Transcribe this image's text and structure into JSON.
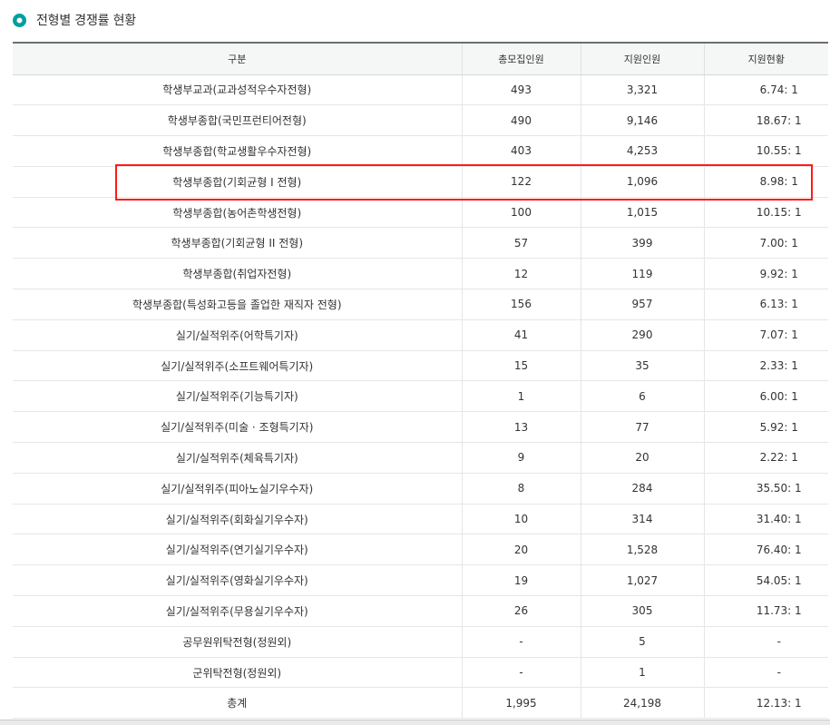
{
  "section": {
    "title": "전형별 경쟁률 현황"
  },
  "table": {
    "headers": [
      "구분",
      "총모집인원",
      "지원인원",
      "지원현황"
    ],
    "rows": [
      [
        "학생부교과(교과성적우수자전형)",
        "493",
        "3,321",
        "6.74: 1"
      ],
      [
        "학생부종합(국민프런티어전형)",
        "490",
        "9,146",
        "18.67: 1"
      ],
      [
        "학생부종합(학교생활우수자전형)",
        "403",
        "4,253",
        "10.55: 1"
      ],
      [
        "학생부종합(기회균형 I 전형)",
        "122",
        "1,096",
        "8.98: 1"
      ],
      [
        "학생부종합(농어촌학생전형)",
        "100",
        "1,015",
        "10.15: 1"
      ],
      [
        "학생부종합(기회균형 II 전형)",
        "57",
        "399",
        "7.00: 1"
      ],
      [
        "학생부종합(취업자전형)",
        "12",
        "119",
        "9.92: 1"
      ],
      [
        "학생부종합(특성화고등을 졸업한 재직자 전형)",
        "156",
        "957",
        "6.13: 1"
      ],
      [
        "실기/실적위주(어학특기자)",
        "41",
        "290",
        "7.07: 1"
      ],
      [
        "실기/실적위주(소프트웨어특기자)",
        "15",
        "35",
        "2.33: 1"
      ],
      [
        "실기/실적위주(기능특기자)",
        "1",
        "6",
        "6.00: 1"
      ],
      [
        "실기/실적위주(미술 · 조형특기자)",
        "13",
        "77",
        "5.92: 1"
      ],
      [
        "실기/실적위주(체육특기자)",
        "9",
        "20",
        "2.22: 1"
      ],
      [
        "실기/실적위주(피아노실기우수자)",
        "8",
        "284",
        "35.50: 1"
      ],
      [
        "실기/실적위주(회화실기우수자)",
        "10",
        "314",
        "31.40: 1"
      ],
      [
        "실기/실적위주(연기실기우수자)",
        "20",
        "1,528",
        "76.40: 1"
      ],
      [
        "실기/실적위주(영화실기우수자)",
        "19",
        "1,027",
        "54.05: 1"
      ],
      [
        "실기/실적위주(무용실기우수자)",
        "26",
        "305",
        "11.73: 1"
      ],
      [
        "공무원위탁전형(정원외)",
        "-",
        "5",
        "-"
      ],
      [
        "군위탁전형(정원외)",
        "-",
        "1",
        "-"
      ],
      [
        "총계",
        "1,995",
        "24,198",
        "12.13: 1"
      ]
    ]
  },
  "highlight": {
    "row_index": 3,
    "color": "#ff1a1a"
  },
  "colors": {
    "accent": "#00a0a0",
    "header_border": "#6c6f72",
    "header_bg": "#f5f6f6"
  },
  "icons": {
    "title_bullet": "circle-bullet-icon"
  }
}
